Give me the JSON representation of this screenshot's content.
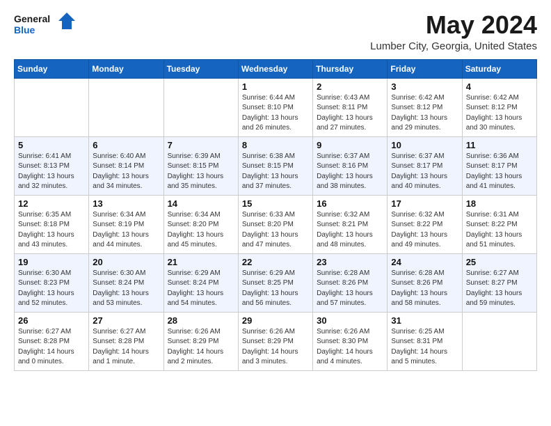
{
  "header": {
    "logo_general": "General",
    "logo_blue": "Blue",
    "title": "May 2024",
    "subtitle": "Lumber City, Georgia, United States"
  },
  "calendar": {
    "days_of_week": [
      "Sunday",
      "Monday",
      "Tuesday",
      "Wednesday",
      "Thursday",
      "Friday",
      "Saturday"
    ],
    "weeks": [
      {
        "days": [
          {
            "num": "",
            "info": ""
          },
          {
            "num": "",
            "info": ""
          },
          {
            "num": "",
            "info": ""
          },
          {
            "num": "1",
            "info": "Sunrise: 6:44 AM\nSunset: 8:10 PM\nDaylight: 13 hours\nand 26 minutes."
          },
          {
            "num": "2",
            "info": "Sunrise: 6:43 AM\nSunset: 8:11 PM\nDaylight: 13 hours\nand 27 minutes."
          },
          {
            "num": "3",
            "info": "Sunrise: 6:42 AM\nSunset: 8:12 PM\nDaylight: 13 hours\nand 29 minutes."
          },
          {
            "num": "4",
            "info": "Sunrise: 6:42 AM\nSunset: 8:12 PM\nDaylight: 13 hours\nand 30 minutes."
          }
        ]
      },
      {
        "days": [
          {
            "num": "5",
            "info": "Sunrise: 6:41 AM\nSunset: 8:13 PM\nDaylight: 13 hours\nand 32 minutes."
          },
          {
            "num": "6",
            "info": "Sunrise: 6:40 AM\nSunset: 8:14 PM\nDaylight: 13 hours\nand 34 minutes."
          },
          {
            "num": "7",
            "info": "Sunrise: 6:39 AM\nSunset: 8:15 PM\nDaylight: 13 hours\nand 35 minutes."
          },
          {
            "num": "8",
            "info": "Sunrise: 6:38 AM\nSunset: 8:15 PM\nDaylight: 13 hours\nand 37 minutes."
          },
          {
            "num": "9",
            "info": "Sunrise: 6:37 AM\nSunset: 8:16 PM\nDaylight: 13 hours\nand 38 minutes."
          },
          {
            "num": "10",
            "info": "Sunrise: 6:37 AM\nSunset: 8:17 PM\nDaylight: 13 hours\nand 40 minutes."
          },
          {
            "num": "11",
            "info": "Sunrise: 6:36 AM\nSunset: 8:17 PM\nDaylight: 13 hours\nand 41 minutes."
          }
        ]
      },
      {
        "days": [
          {
            "num": "12",
            "info": "Sunrise: 6:35 AM\nSunset: 8:18 PM\nDaylight: 13 hours\nand 43 minutes."
          },
          {
            "num": "13",
            "info": "Sunrise: 6:34 AM\nSunset: 8:19 PM\nDaylight: 13 hours\nand 44 minutes."
          },
          {
            "num": "14",
            "info": "Sunrise: 6:34 AM\nSunset: 8:20 PM\nDaylight: 13 hours\nand 45 minutes."
          },
          {
            "num": "15",
            "info": "Sunrise: 6:33 AM\nSunset: 8:20 PM\nDaylight: 13 hours\nand 47 minutes."
          },
          {
            "num": "16",
            "info": "Sunrise: 6:32 AM\nSunset: 8:21 PM\nDaylight: 13 hours\nand 48 minutes."
          },
          {
            "num": "17",
            "info": "Sunrise: 6:32 AM\nSunset: 8:22 PM\nDaylight: 13 hours\nand 49 minutes."
          },
          {
            "num": "18",
            "info": "Sunrise: 6:31 AM\nSunset: 8:22 PM\nDaylight: 13 hours\nand 51 minutes."
          }
        ]
      },
      {
        "days": [
          {
            "num": "19",
            "info": "Sunrise: 6:30 AM\nSunset: 8:23 PM\nDaylight: 13 hours\nand 52 minutes."
          },
          {
            "num": "20",
            "info": "Sunrise: 6:30 AM\nSunset: 8:24 PM\nDaylight: 13 hours\nand 53 minutes."
          },
          {
            "num": "21",
            "info": "Sunrise: 6:29 AM\nSunset: 8:24 PM\nDaylight: 13 hours\nand 54 minutes."
          },
          {
            "num": "22",
            "info": "Sunrise: 6:29 AM\nSunset: 8:25 PM\nDaylight: 13 hours\nand 56 minutes."
          },
          {
            "num": "23",
            "info": "Sunrise: 6:28 AM\nSunset: 8:26 PM\nDaylight: 13 hours\nand 57 minutes."
          },
          {
            "num": "24",
            "info": "Sunrise: 6:28 AM\nSunset: 8:26 PM\nDaylight: 13 hours\nand 58 minutes."
          },
          {
            "num": "25",
            "info": "Sunrise: 6:27 AM\nSunset: 8:27 PM\nDaylight: 13 hours\nand 59 minutes."
          }
        ]
      },
      {
        "days": [
          {
            "num": "26",
            "info": "Sunrise: 6:27 AM\nSunset: 8:28 PM\nDaylight: 14 hours\nand 0 minutes."
          },
          {
            "num": "27",
            "info": "Sunrise: 6:27 AM\nSunset: 8:28 PM\nDaylight: 14 hours\nand 1 minute."
          },
          {
            "num": "28",
            "info": "Sunrise: 6:26 AM\nSunset: 8:29 PM\nDaylight: 14 hours\nand 2 minutes."
          },
          {
            "num": "29",
            "info": "Sunrise: 6:26 AM\nSunset: 8:29 PM\nDaylight: 14 hours\nand 3 minutes."
          },
          {
            "num": "30",
            "info": "Sunrise: 6:26 AM\nSunset: 8:30 PM\nDaylight: 14 hours\nand 4 minutes."
          },
          {
            "num": "31",
            "info": "Sunrise: 6:25 AM\nSunset: 8:31 PM\nDaylight: 14 hours\nand 5 minutes."
          },
          {
            "num": "",
            "info": ""
          }
        ]
      }
    ]
  }
}
